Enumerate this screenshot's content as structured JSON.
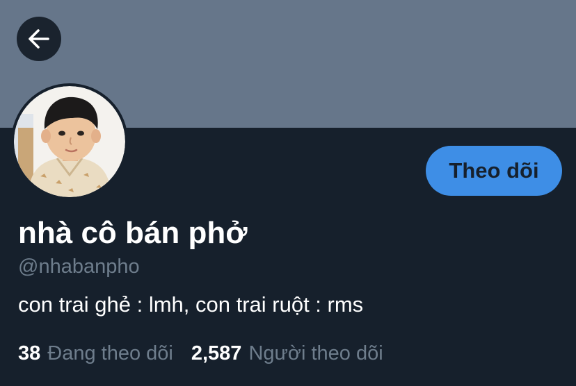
{
  "header": {
    "back_icon": "arrow-left-icon",
    "banner_color": "#66768a"
  },
  "profile": {
    "display_name": "nhà cô bán phở",
    "handle": "@nhabanpho",
    "bio": "con trai ghẻ : lmh, con trai ruột : rms",
    "follow_button_label": "Theo dõi",
    "stats": {
      "following_count": "38",
      "following_label": "Đang theo dõi",
      "followers_count": "2,587",
      "followers_label": "Người theo dõi"
    }
  },
  "colors": {
    "background": "#16202c",
    "accent": "#3e8ee6",
    "secondary_text": "#6e7d8c",
    "primary_text": "#ffffff"
  }
}
